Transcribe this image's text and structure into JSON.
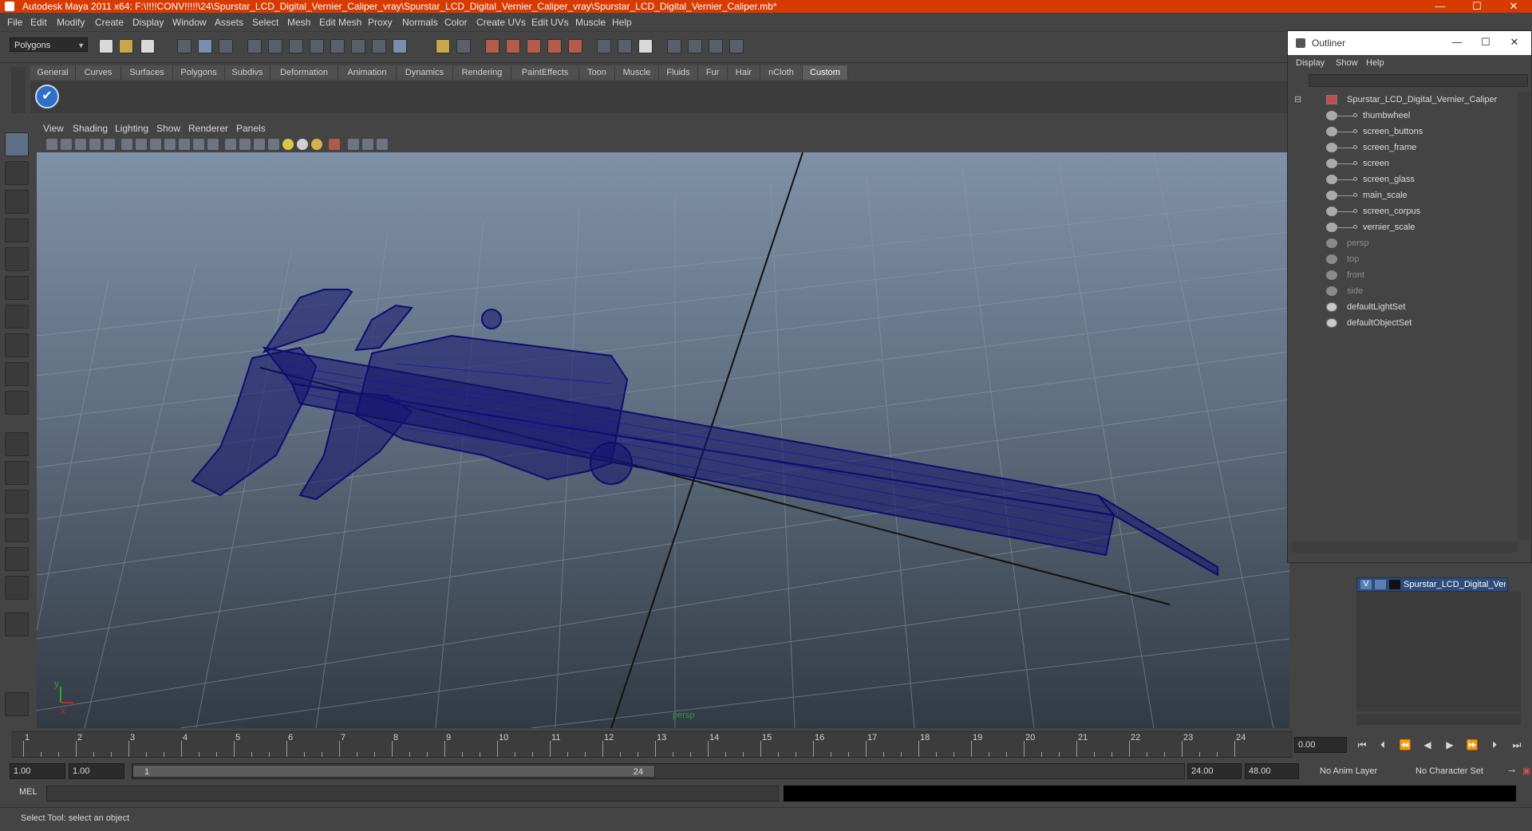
{
  "window": {
    "title": "Autodesk Maya 2011 x64: F:\\!!!!CONV!!!!!\\24\\Spurstar_LCD_Digital_Vernier_Caliper_vray\\Spurstar_LCD_Digital_Vernier_Caliper_vray\\Spurstar_LCD_Digital_Vernier_Caliper.mb*",
    "minimize": "—",
    "maximize": "☐",
    "close": "✕"
  },
  "menu": [
    "File",
    "Edit",
    "Modify",
    "Create",
    "Display",
    "Window",
    "Assets",
    "Select",
    "Mesh",
    "Edit Mesh",
    "Proxy",
    "Normals",
    "Color",
    "Create UVs",
    "Edit UVs",
    "Muscle",
    "Help"
  ],
  "toolbar": {
    "mode": "Polygons"
  },
  "shelf": {
    "tabs": [
      "General",
      "Curves",
      "Surfaces",
      "Polygons",
      "Subdivs",
      "Deformation",
      "Animation",
      "Dynamics",
      "Rendering",
      "PaintEffects",
      "Toon",
      "Muscle",
      "Fluids",
      "Fur",
      "Hair",
      "nCloth",
      "Custom"
    ],
    "active": "Custom"
  },
  "viewport": {
    "menu": [
      "View",
      "Shading",
      "Lighting",
      "Show",
      "Renderer",
      "Panels"
    ],
    "camera": "persp",
    "axis_y": "y",
    "axis_x": "x"
  },
  "outliner": {
    "title": "Outliner",
    "menu": [
      "Display",
      "Show",
      "Help"
    ],
    "root": "Spurstar_LCD_Digital_Vernier_Caliper",
    "children": [
      "thumbwheel",
      "screen_buttons",
      "screen_frame",
      "screen",
      "screen_glass",
      "main_scale",
      "screen_corpus",
      "vernier_scale"
    ],
    "cameras": [
      "persp",
      "top",
      "front",
      "side"
    ],
    "sets": [
      "defaultLightSet",
      "defaultObjectSet"
    ]
  },
  "layers": {
    "name": "Spurstar_LCD_Digital_Ver",
    "visible": "V"
  },
  "timeline": {
    "ticks": [
      "1",
      "2",
      "3",
      "4",
      "5",
      "6",
      "7",
      "8",
      "9",
      "10",
      "11",
      "12",
      "13",
      "14",
      "15",
      "16",
      "17",
      "18",
      "19",
      "20",
      "21",
      "22",
      "23",
      "24"
    ],
    "current_time": "0.00"
  },
  "range": {
    "start": "1.00",
    "playback_start": "1.00",
    "slider_start": "1",
    "slider_end": "24",
    "playback_end": "24.00",
    "end": "48.00",
    "anim_layer": "No Anim Layer",
    "character_set": "No Character Set"
  },
  "command": {
    "label": "MEL"
  },
  "help": {
    "text": "Select Tool: select an object"
  },
  "colors": {
    "titlebar": "#d83b01",
    "wireframe": "#0d0d6e",
    "layer": "#2e4a76"
  }
}
